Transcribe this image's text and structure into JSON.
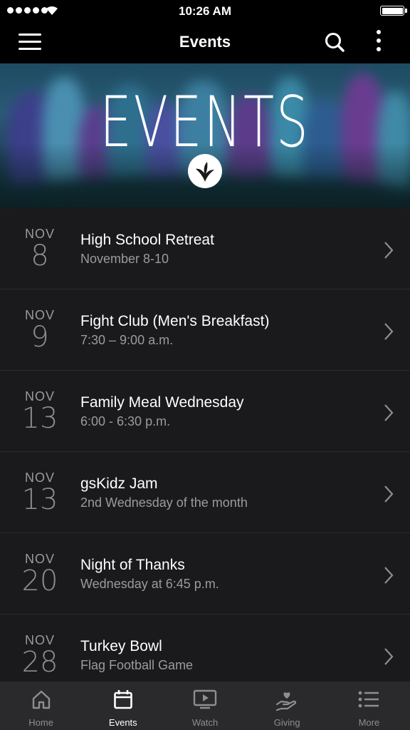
{
  "status_bar": {
    "time": "10:26 AM"
  },
  "nav": {
    "title": "Events"
  },
  "banner": {
    "title": "EVENTS"
  },
  "events": [
    {
      "month": "NOV",
      "day": "8",
      "title": "High School Retreat",
      "subtitle": "November 8-10"
    },
    {
      "month": "NOV",
      "day": "9",
      "title": "Fight Club (Men's Breakfast)",
      "subtitle": "7:30 – 9:00 a.m."
    },
    {
      "month": "NOV",
      "day": "13",
      "title": "Family Meal Wednesday",
      "subtitle": "6:00 - 6:30 p.m."
    },
    {
      "month": "NOV",
      "day": "13",
      "title": "gsKidz Jam",
      "subtitle": "2nd Wednesday of the month"
    },
    {
      "month": "NOV",
      "day": "20",
      "title": "Night of Thanks",
      "subtitle": "Wednesday at 6:45 p.m."
    },
    {
      "month": "NOV",
      "day": "28",
      "title": "Turkey Bowl",
      "subtitle": "Flag Football Game"
    }
  ],
  "tabs": [
    {
      "label": "Home",
      "icon": "home-icon",
      "active": false
    },
    {
      "label": "Events",
      "icon": "calendar-icon",
      "active": true
    },
    {
      "label": "Watch",
      "icon": "play-screen-icon",
      "active": false
    },
    {
      "label": "Giving",
      "icon": "giving-hand-icon",
      "active": false
    },
    {
      "label": "More",
      "icon": "list-icon",
      "active": false
    }
  ],
  "colors": {
    "background": "#1a1a1c",
    "bar": "#000000",
    "tab_bar": "#2a2a2c",
    "muted_text": "#9b9b9d"
  }
}
